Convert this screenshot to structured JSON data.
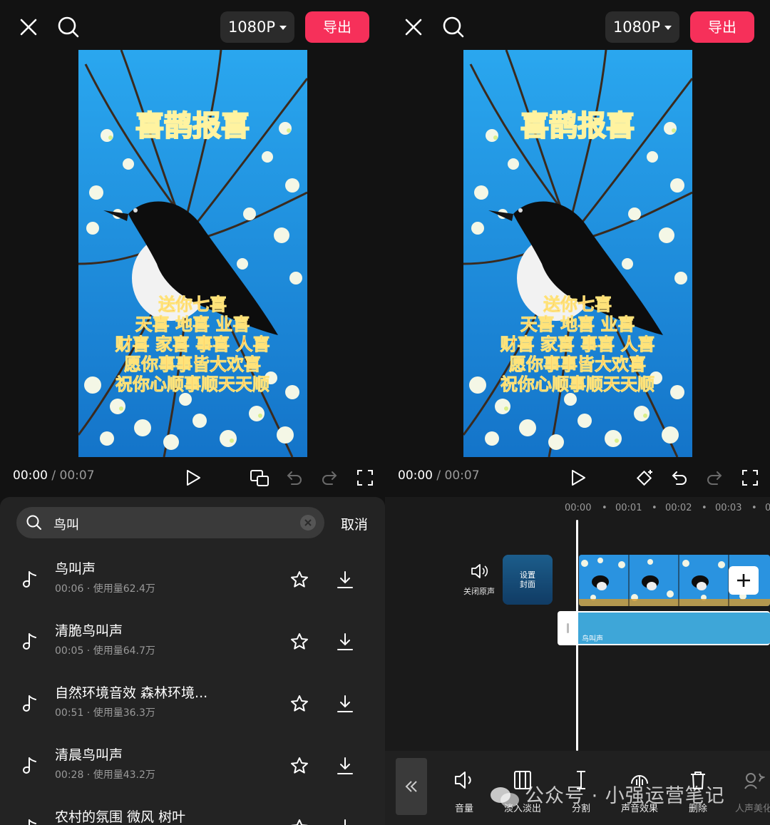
{
  "editor": {
    "resolution": "1080P",
    "export_label": "导出",
    "time_current": "00:00",
    "time_separator": "/",
    "time_total": "00:07"
  },
  "video": {
    "title": "喜鹊报喜",
    "title_chars": [
      "喜",
      "鹊",
      "报",
      "喜"
    ],
    "blessing_lines": [
      "送你七喜",
      "天喜  地喜  业喜",
      "财喜  家喜  事喜  人喜",
      "愿你事事皆大欢喜",
      "祝你心顺事顺天天顺"
    ]
  },
  "search": {
    "query": "鸟叫",
    "cancel_label": "取消"
  },
  "results": [
    {
      "title": "鸟叫声",
      "duration": "00:06",
      "usage": "使用量62.4万"
    },
    {
      "title": "清脆鸟叫声",
      "duration": "00:05",
      "usage": "使用量64.7万"
    },
    {
      "title": "自然环境音效 森林环境...",
      "duration": "00:51",
      "usage": "使用量36.3万"
    },
    {
      "title": "清晨鸟叫声",
      "duration": "00:28",
      "usage": "使用量43.2万"
    },
    {
      "title": "农村的氛围 微风 树叶",
      "duration": "",
      "usage": ""
    }
  ],
  "timeline": {
    "ruler": [
      "00:00",
      "00:01",
      "00:02",
      "00:03",
      "0"
    ],
    "mute_label": "关闭原声",
    "cover_label": "设置\n封面",
    "cover_line1": "设置",
    "cover_line2": "封面",
    "audio_track_label": "鸟叫声"
  },
  "toolbar": {
    "tools": [
      "音量",
      "淡入淡出",
      "分割",
      "声音效果",
      "删除",
      "人声美化"
    ]
  },
  "watermark": "公众号 · 小强运营笔记",
  "colors": {
    "accent": "#f6305a",
    "audio_track": "#3ea6d8",
    "sky": "#1e9be4"
  }
}
